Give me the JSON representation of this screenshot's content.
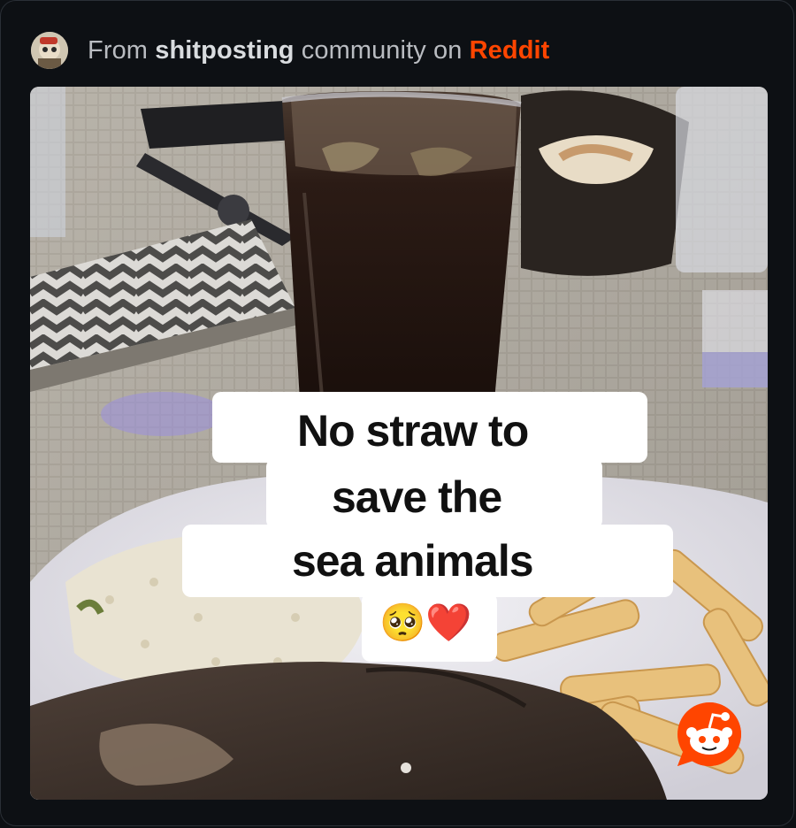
{
  "header": {
    "prefix": "From ",
    "community": "shitposting",
    "middle": " community on ",
    "platform": "Reddit"
  },
  "caption": {
    "line1": "No straw to",
    "line2": "save the",
    "line3": "sea animals",
    "emoji": "🥺❤️"
  },
  "icons": {
    "avatar": "community-avatar-icon",
    "badge": "reddit-snoo-icon"
  },
  "colors": {
    "background": "#0d1014",
    "brand": "#ff4500",
    "text_muted": "#b9bcc1"
  }
}
